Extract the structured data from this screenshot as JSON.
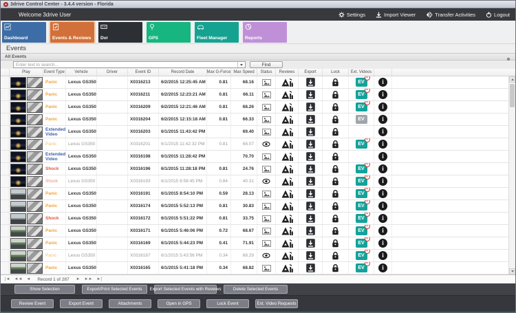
{
  "window_title": "3drive Control Center - 3.4.4 version - Florida",
  "topbar": {
    "welcome": "Welcome 3drive User",
    "actions": [
      {
        "label": "Settings",
        "icon": "gear-icon"
      },
      {
        "label": "Import Viewer",
        "icon": "import-icon"
      },
      {
        "label": "Transfer Activities",
        "icon": "transfer-icon"
      },
      {
        "label": "Logout",
        "icon": "power-icon"
      }
    ]
  },
  "tabs": [
    {
      "label": "Dashboard",
      "icon": "dashboard-icon",
      "color": "#3d6da6",
      "active": false
    },
    {
      "label": "Events & Reviews",
      "icon": "events-icon",
      "color": "#d2703a",
      "active": true
    },
    {
      "label": "Dvr",
      "icon": "dvr-icon",
      "color": "#2c2f34",
      "active": false
    },
    {
      "label": "GPS",
      "icon": "gps-icon",
      "color": "#17b57f",
      "active": false
    },
    {
      "label": "Fleet Manager",
      "icon": "fleet-icon",
      "color": "#16a290",
      "active": false
    },
    {
      "label": "Reports",
      "icon": "reports-icon",
      "color": "#bf90d8",
      "active": false
    }
  ],
  "page": {
    "heading": "Events",
    "panel_title": "All Events"
  },
  "search": {
    "placeholder": "Enter text to search...",
    "find_label": "Find"
  },
  "table": {
    "columns": [
      "Play",
      "Event Type",
      "Vehicle",
      "Driver",
      "Event ID",
      "Record Date",
      "Max G-Force",
      "Max Speed",
      "Status",
      "Reviews",
      "Export",
      "Lock",
      "Ext. Videos"
    ],
    "ev_chip_label": "EV",
    "ev_badge_count": "0",
    "rows": [
      {
        "type": "Panic",
        "kind": "panic",
        "vehicle": "Lexus GS350",
        "driver": "",
        "id": "X0316213",
        "date": "6/2/2015 12:25:45 AM",
        "g": "0.81",
        "speed": "68.16",
        "status": "photo",
        "ev": "badge",
        "read": false,
        "road": "night"
      },
      {
        "type": "Panic",
        "kind": "panic",
        "vehicle": "Lexus GS350",
        "driver": "",
        "id": "X0316211",
        "date": "6/2/2015 12:23:21 AM",
        "g": "0.81",
        "speed": "66.11",
        "status": "photo",
        "ev": "badge",
        "read": false,
        "road": "night"
      },
      {
        "type": "Panic",
        "kind": "panic",
        "vehicle": "Lexus GS350",
        "driver": "",
        "id": "X0316209",
        "date": "6/2/2015 12:21:46 AM",
        "g": "0.81",
        "speed": "68.26",
        "status": "photo",
        "ev": "badge",
        "read": false,
        "road": "night"
      },
      {
        "type": "Panic",
        "kind": "panic",
        "vehicle": "Lexus GS350",
        "driver": "",
        "id": "X0316204",
        "date": "6/2/2015 12:15:18 AM",
        "g": "0.81",
        "speed": "66.33",
        "status": "photo",
        "ev": "gray",
        "read": false,
        "road": "night"
      },
      {
        "type": "Extended Video",
        "kind": "extended",
        "vehicle": "Lexus GS350",
        "driver": "",
        "id": "X0316203",
        "date": "6/1/2015 11:43:42 PM",
        "g": "",
        "speed": "69.40",
        "status": "photo",
        "ev": "none",
        "read": false,
        "road": "night"
      },
      {
        "type": "Panic",
        "kind": "panic",
        "vehicle": "Lexus GS350",
        "driver": "",
        "id": "X0316201",
        "date": "6/1/2015 11:42:32 PM",
        "g": "0.81",
        "speed": "68.07",
        "status": "eye",
        "ev": "badge",
        "read": true,
        "road": "night"
      },
      {
        "type": "Extended Video",
        "kind": "extended",
        "vehicle": "Lexus GS350",
        "driver": "",
        "id": "X0316198",
        "date": "6/1/2015 11:28:42 PM",
        "g": "",
        "speed": "70.70",
        "status": "photo",
        "ev": "none",
        "read": false,
        "road": "night"
      },
      {
        "type": "Shock",
        "kind": "shock",
        "vehicle": "Lexus GS350",
        "driver": "",
        "id": "X0316196",
        "date": "6/1/2015 11:28:18 PM",
        "g": "0.81",
        "speed": "24.76",
        "status": "photo",
        "ev": "badge",
        "read": false,
        "road": "night"
      },
      {
        "type": "Shock",
        "kind": "shock",
        "vehicle": "Lexus GS350",
        "driver": "",
        "id": "X0316193",
        "date": "6/1/2015 8:58:45 PM",
        "g": "0.84",
        "speed": "40.31",
        "status": "eye",
        "ev": "badge",
        "read": true,
        "road": "night"
      },
      {
        "type": "Panic",
        "kind": "panic",
        "vehicle": "Lexus GS350",
        "driver": "",
        "id": "X0316191",
        "date": "6/1/2015 8:54:10 PM",
        "g": "0.59",
        "speed": "28.13",
        "status": "photo",
        "ev": "badge",
        "read": false,
        "road": "day"
      },
      {
        "type": "Panic",
        "kind": "panic",
        "vehicle": "Lexus GS350",
        "driver": "",
        "id": "X0316174",
        "date": "6/1/2015 5:52:13 PM",
        "g": "0.81",
        "speed": "30.83",
        "status": "photo",
        "ev": "badge",
        "read": false,
        "road": "day"
      },
      {
        "type": "Shock",
        "kind": "shock",
        "vehicle": "Lexus GS350",
        "driver": "",
        "id": "X0316172",
        "date": "6/1/2015 5:51:22 PM",
        "g": "0.81",
        "speed": "33.75",
        "status": "photo",
        "ev": "badge",
        "read": false,
        "road": "day"
      },
      {
        "type": "Panic",
        "kind": "panic",
        "vehicle": "Lexus GS350",
        "driver": "",
        "id": "X0316171",
        "date": "6/1/2015 5:46:06 PM",
        "g": "0.72",
        "speed": "68.67",
        "status": "photo",
        "ev": "badge",
        "read": false,
        "road": "green"
      },
      {
        "type": "Panic",
        "kind": "panic",
        "vehicle": "Lexus GS350",
        "driver": "",
        "id": "X0316169",
        "date": "6/1/2015 5:44:23 PM",
        "g": "0.41",
        "speed": "71.91",
        "status": "photo",
        "ev": "badge",
        "read": false,
        "road": "green"
      },
      {
        "type": "Panic",
        "kind": "panic",
        "vehicle": "Lexus GS350",
        "driver": "",
        "id": "X0316167",
        "date": "6/1/2015 5:43:56 PM",
        "g": "0.34",
        "speed": "68.29",
        "status": "eye",
        "ev": "badge",
        "read": true,
        "road": "green"
      },
      {
        "type": "Panic",
        "kind": "panic",
        "vehicle": "Lexus GS350",
        "driver": "",
        "id": "X0316165",
        "date": "6/1/2015 5:41:18 PM",
        "g": "0.34",
        "speed": "68.82",
        "status": "photo",
        "ev": "badge",
        "read": false,
        "road": "green"
      }
    ]
  },
  "pager": {
    "label": "Record 1 of 287",
    "left_buttons": [
      "|◄",
      "◄◄",
      "◄"
    ],
    "right_buttons": [
      "►",
      "►►",
      "►|"
    ]
  },
  "footer": {
    "row1": [
      "Show Selection",
      "Export/Print Selected Events",
      "Export Selected Events with Reviews",
      "Delete Selected  Events"
    ],
    "row2": [
      "Review Event",
      "Export Event",
      "Attachments",
      "Open in GPS",
      "Lock Event",
      "Ext. Video Requests"
    ]
  },
  "colors": {
    "accent_teal": "#14a29a",
    "badge_red": "#d23b32",
    "panic": "#f2a33c",
    "shock": "#e5533a",
    "extended_video": "#3a5fae"
  }
}
